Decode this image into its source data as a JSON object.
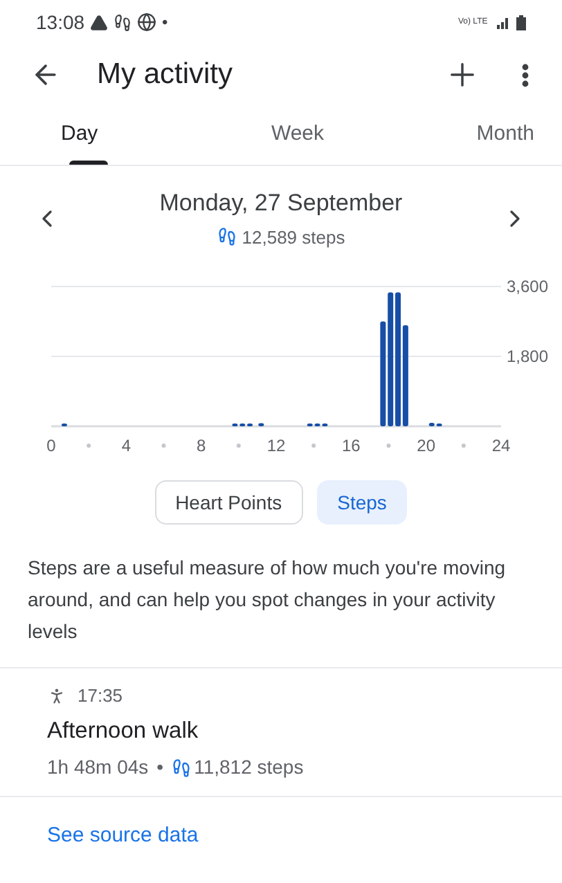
{
  "status_bar": {
    "time": "13:08",
    "dot": "•",
    "network": "Vo) LTE"
  },
  "app_bar": {
    "title": "My activity"
  },
  "tabs": [
    {
      "label": "Day",
      "selected": true
    },
    {
      "label": "Week",
      "selected": false
    },
    {
      "label": "Month",
      "selected": false
    }
  ],
  "date_header": {
    "date": "Monday, 27 September",
    "steps": "12,589 steps"
  },
  "chart_data": {
    "type": "bar",
    "x": [
      0.7,
      9.8,
      10.2,
      10.6,
      11.2,
      13.8,
      14.2,
      14.6,
      17.7,
      18.1,
      18.5,
      18.9,
      20.3,
      20.7
    ],
    "series": [
      {
        "color": "#174ea6",
        "values": [
          60,
          40,
          40,
          40,
          80,
          30,
          30,
          30,
          2700,
          3450,
          3450,
          2600,
          90,
          40
        ]
      }
    ],
    "xlim": [
      0,
      24
    ],
    "ylim": [
      0,
      3600
    ],
    "xticks": [
      0,
      4,
      8,
      12,
      16,
      20,
      24
    ],
    "yticks": [
      {
        "value": 1800,
        "label": "1,800"
      },
      {
        "value": 3600,
        "label": "3,600"
      }
    ]
  },
  "metric_chips": [
    {
      "label": "Heart Points",
      "selected": false
    },
    {
      "label": "Steps",
      "selected": true
    }
  ],
  "description": "Steps are a useful measure of how much you're moving around, and can help you spot changes in your activity levels",
  "activity": {
    "time": "17:35",
    "title": "Afternoon walk",
    "duration": "1h 48m 04s",
    "separator": "•",
    "steps": "11,812 steps"
  },
  "link": "See source data"
}
